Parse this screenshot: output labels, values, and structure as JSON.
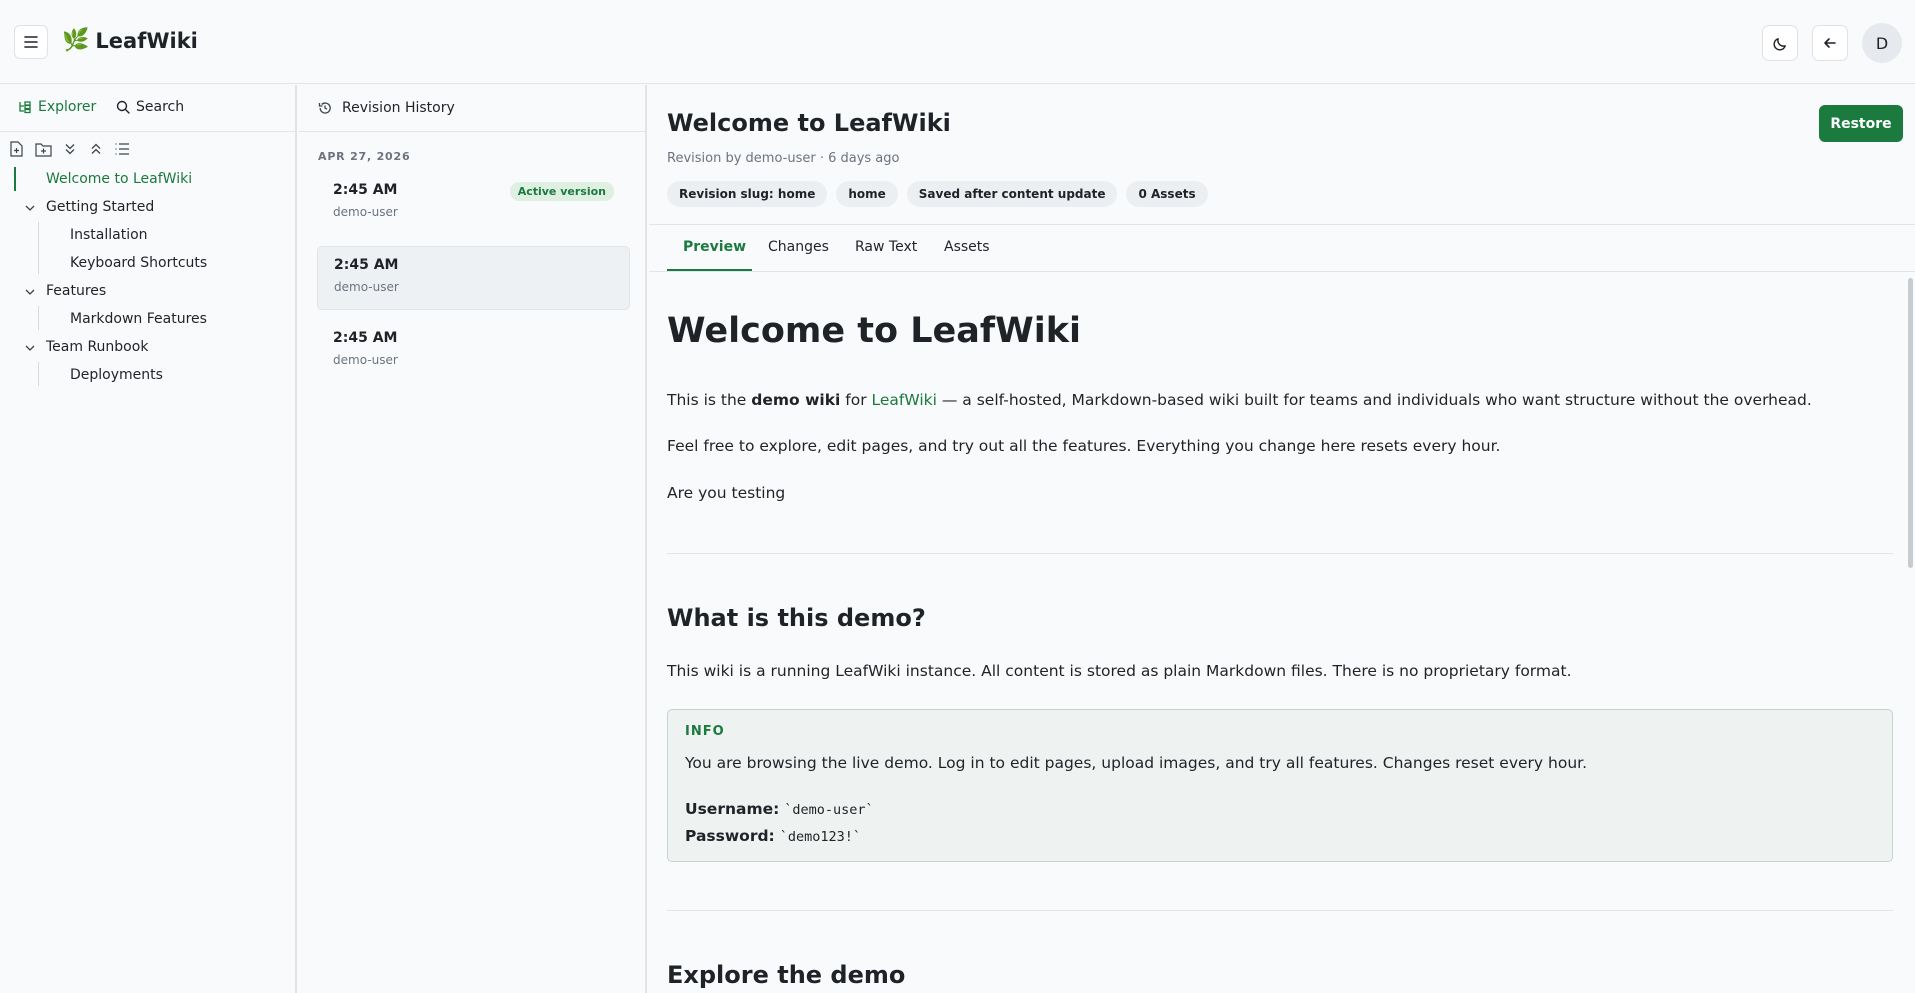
{
  "app": {
    "name": "LeafWiki",
    "logo_icon": "leaf-icon"
  },
  "header": {
    "theme_icon": "moon-icon",
    "back_icon": "arrow-left-icon",
    "avatar_initial": "D"
  },
  "sidebar": {
    "tabs": [
      {
        "label": "Explorer",
        "icon": "tree-icon",
        "active": true
      },
      {
        "label": "Search",
        "icon": "search-icon"
      }
    ],
    "tools": [
      "new-page-icon",
      "new-folder-icon",
      "expand-all-icon",
      "collapse-all-icon",
      "list-icon"
    ],
    "tree": [
      {
        "label": "Welcome to LeafWiki",
        "active": true
      },
      {
        "label": "Getting Started",
        "expanded": true
      },
      {
        "label": "Installation"
      },
      {
        "label": "Keyboard Shortcuts"
      },
      {
        "label": "Features",
        "expanded": true
      },
      {
        "label": "Markdown Features"
      },
      {
        "label": "Team Runbook",
        "expanded": true
      },
      {
        "label": "Deployments"
      }
    ]
  },
  "revisions": {
    "title": "Revision History",
    "icon": "history-icon",
    "date": "APR 27, 2026",
    "items": [
      {
        "time": "2:45 AM",
        "user": "demo-user",
        "badge": "Active version"
      },
      {
        "time": "2:45 AM",
        "user": "demo-user",
        "selected": true
      },
      {
        "time": "2:45 AM",
        "user": "demo-user"
      }
    ]
  },
  "main": {
    "title": "Welcome to LeafWiki",
    "subtitle": "Revision by demo-user · 6 days ago",
    "restore_label": "Restore",
    "chips": [
      "Revision slug: home",
      "home",
      "Saved after content update",
      "0 Assets"
    ],
    "tabs": [
      "Preview",
      "Changes",
      "Raw Text",
      "Assets"
    ],
    "active_tab": "Preview"
  },
  "content": {
    "h1": "Welcome to LeafWiki",
    "p1": {
      "a": "This is the ",
      "bold": "demo wiki",
      "b": " for ",
      "link": "LeafWiki",
      "c": " — a self-hosted, Markdown-based wiki built for teams and individuals who want structure without the overhead."
    },
    "p2": "Feel free to explore, edit pages, and try out all the features. Everything you change here resets every hour.",
    "p3": "Are you testing",
    "h2_demo": "What is this demo?",
    "p4": "This wiki is a running LeafWiki instance. All content is stored as plain Markdown files. There is no proprietary format.",
    "info": {
      "label": "INFO",
      "text": "You are browsing the live demo. Log in to edit pages, upload images, and try all features. Changes reset every hour.",
      "username_label": "Username:",
      "username_value": "`demo-user`",
      "password_label": "Password:",
      "password_value": "`demo123!`"
    },
    "h2_explore": "Explore the demo"
  },
  "colors": {
    "accent": "#1b7a3d",
    "background": "#f8fafb",
    "border": "#e3e6e8"
  }
}
